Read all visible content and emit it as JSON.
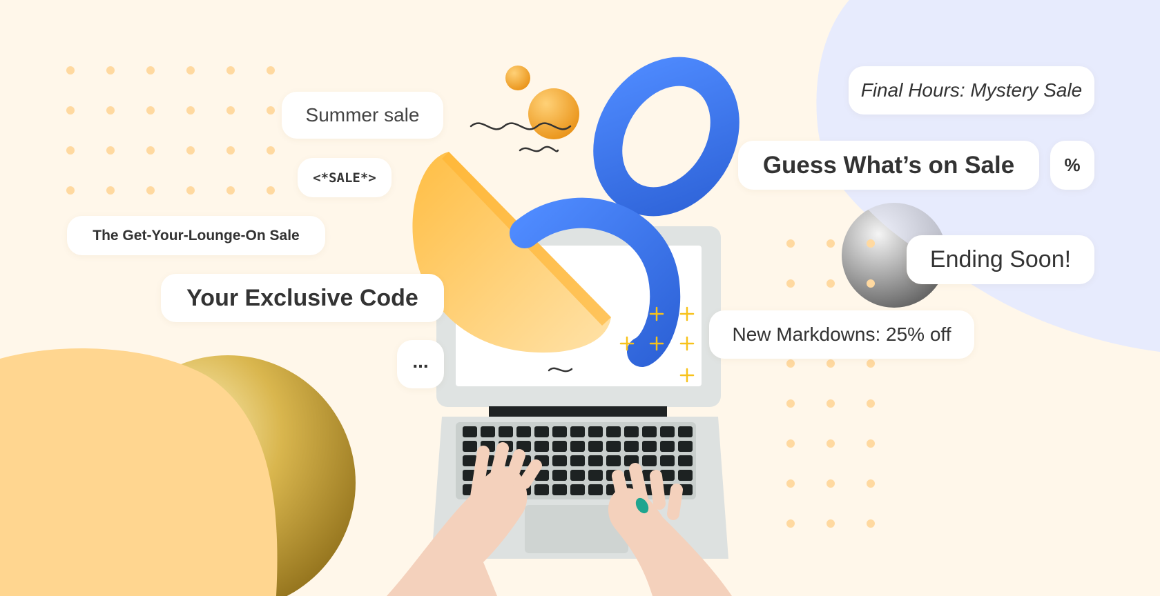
{
  "labels": {
    "summer_sale": "Summer sale",
    "sale_tag": "<*SALE*>",
    "lounge_sale": "The Get-Your-Lounge-On Sale",
    "exclusive_code": "Your Exclusive Code",
    "ellipsis": "...",
    "final_hours": "Final Hours: Mystery Sale",
    "guess_whats_on_sale": "Guess What’s on Sale",
    "percent": "%",
    "ending_soon": "Ending Soon!",
    "new_markdowns": "New Markdowns: 25% off"
  },
  "colors": {
    "background": "#fff7ea",
    "lavender_blob": "#e7ebfd",
    "orange_blob": "#ffd690",
    "gold_sphere": "#c9a83c",
    "orange_sphere": "#f2a22a",
    "blue_ring": "#3f7bf0",
    "yellow_half_disc": "#ffc14e",
    "dot": "#ffd9a0",
    "plus": "#f7c21b",
    "laptop_body": "#dfe3e2"
  },
  "icons": [
    "dot-grid-pattern",
    "wave-squiggle-icon",
    "plus-sparkle-icon",
    "ring-3d-icon",
    "arc-3d-icon",
    "half-disc-3d-icon",
    "sphere-3d-icon"
  ]
}
